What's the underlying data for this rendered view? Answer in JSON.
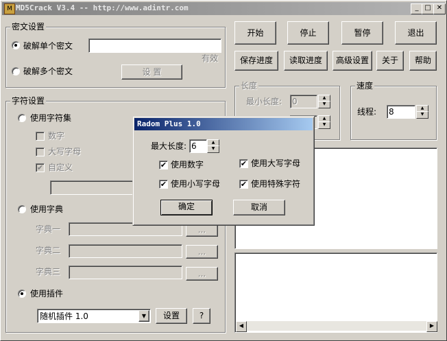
{
  "window": {
    "title": "MD5Crack V3.4 -- http://www.adintr.com"
  },
  "cipher_group": {
    "title": "密文设置",
    "single_label": "破解单个密文",
    "single_value": "",
    "status": "有效",
    "multi_label": "破解多个密文",
    "settings_button": "设 置"
  },
  "charset_group": {
    "title": "字符设置",
    "use_charset": "使用字符集",
    "digits": "数字",
    "upper": "大写字母",
    "custom": "自定义",
    "custom_value": "",
    "use_dict": "使用字典",
    "dict1": "字典一",
    "dict2": "字典二",
    "dict3": "字典三",
    "browse": "...",
    "use_plugin": "使用插件",
    "plugin_selected": "随机插件 1.0",
    "plugin_settings": "设置",
    "plugin_help": "?"
  },
  "toolbar": {
    "start": "开始",
    "stop": "停止",
    "pause": "暂停",
    "exit": "退出",
    "save": "保存进度",
    "load": "读取进度",
    "advanced": "高级设置",
    "about": "关于",
    "help": "帮助"
  },
  "length_group": {
    "title": "长度",
    "min_label": "最小长度:",
    "min_value": "0",
    "max_value": ""
  },
  "speed_group": {
    "title": "速度",
    "threads_label": "线程:",
    "threads_value": "8"
  },
  "dialog": {
    "title": "Radom Plus 1.0",
    "max_len_label": "最大长度:",
    "max_len_value": "6",
    "use_digits": "使用数字",
    "use_upper": "使用大写字母",
    "use_lower": "使用小写字母",
    "use_special": "使用特殊字符",
    "ok": "确定",
    "cancel": "取消"
  },
  "colors": {
    "face": "#d4d0c8",
    "dialog_title_start": "#0a246a",
    "dialog_title_end": "#a6caf0"
  }
}
